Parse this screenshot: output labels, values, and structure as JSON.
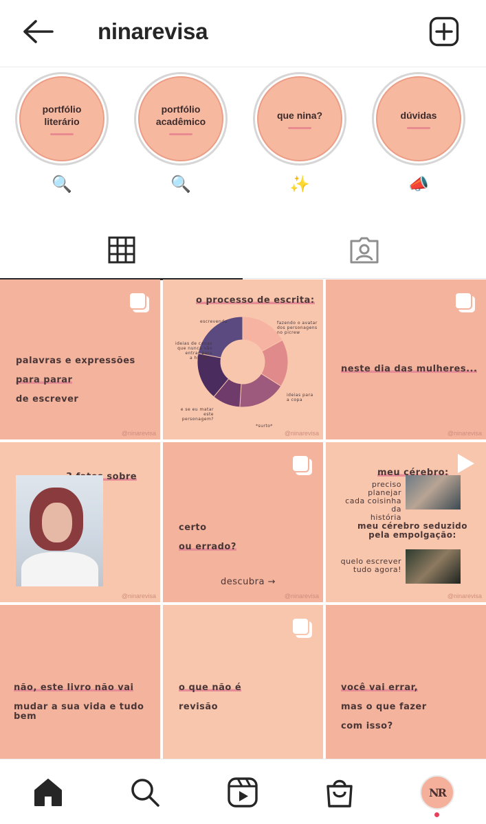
{
  "header": {
    "username": "ninarevisa",
    "back_icon": "arrow-left-icon",
    "new_post_icon": "plus-square-icon"
  },
  "highlights": [
    {
      "title": "portfólio\nliterário",
      "emoji": "🔍"
    },
    {
      "title": "portfólio\nacadêmico",
      "emoji": "🔍"
    },
    {
      "title": "que nina?",
      "emoji": "✨"
    },
    {
      "title": "dúvidas",
      "emoji": "📣"
    }
  ],
  "tabs": {
    "grid_icon": "grid-icon",
    "tagged_icon": "tagged-person-icon"
  },
  "posts": {
    "handle": "@ninarevisa",
    "p1": {
      "line1": "palavras e expressões",
      "line2": "para parar",
      "line3": "de escrever"
    },
    "p2": {
      "title": "o processo de escrita:",
      "labels": {
        "escrevendo": "escrevendo",
        "avatar": "fazendo o avatar\ndos personagens\nno picrew",
        "cenas": "ideias de cenas\nque nunca vão\nentrar para\na história",
        "copa": "ideias para\na copa",
        "matar": "e se eu matar\neste personagem?",
        "surto": "*surto*"
      },
      "chart_data": {
        "type": "pie",
        "categories": [
          "fazendo o avatar",
          "ideias para a copa",
          "surto",
          "e se eu matar",
          "ideias de cenas",
          "escrevendo"
        ],
        "values": [
          17,
          17,
          17,
          10,
          17,
          22
        ],
        "colors": [
          "#f6b3a1",
          "#e08a8c",
          "#9d5a7c",
          "#6e3b6b",
          "#4b2c5e",
          "#5a4a80"
        ]
      }
    },
    "p3": {
      "text": "neste dia das mulheres..."
    },
    "p4": {
      "title": "3 fatos sobre mim"
    },
    "p5": {
      "line1": "certo",
      "line2": "ou errado?",
      "cta": "descubra →"
    },
    "p6": {
      "title": "meu cérebro:",
      "line1": "preciso planejar\ncada coisinha da\nhistória",
      "subtitle": "meu cérebro seduzido\npela empolgação:",
      "line2": "quelo escrever\ntudo agora!"
    },
    "p7": {
      "line1": "não, este livro não vai",
      "line2": "mudar a sua vida e tudo bem"
    },
    "p8": {
      "line1": "o que não é",
      "line2": "revisão"
    },
    "p9": {
      "line1": "você vai errar,",
      "line2": "mas o que fazer",
      "line3": "com isso?"
    }
  },
  "nav": {
    "home_icon": "home-icon",
    "search_icon": "search-icon",
    "reels_icon": "reels-icon",
    "shop_icon": "shopping-bag-icon",
    "avatar_initials": "NR"
  }
}
